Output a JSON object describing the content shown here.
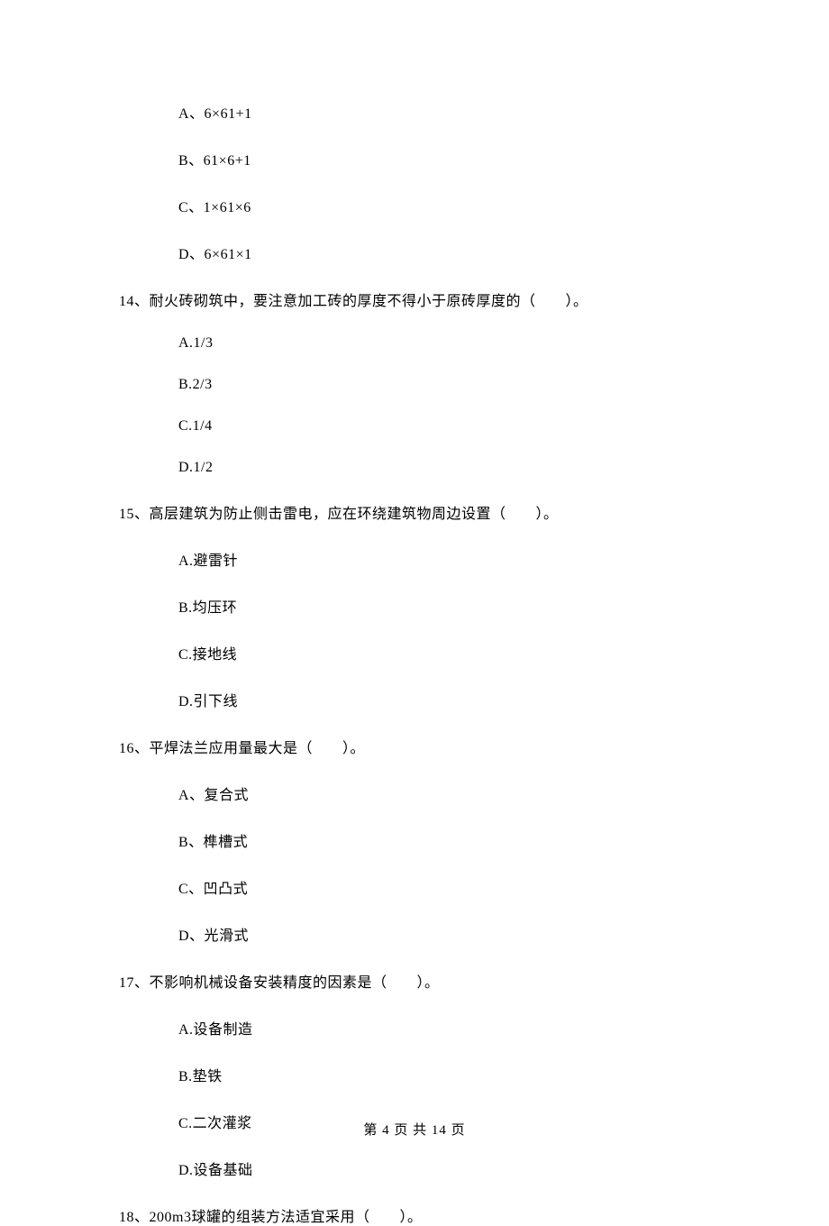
{
  "q13_options": {
    "a": "A、6×61+1",
    "b": "B、61×6+1",
    "c": "C、1×61×6",
    "d": "D、6×61×1"
  },
  "q14": {
    "text": "14、耐火砖砌筑中，要注意加工砖的厚度不得小于原砖厚度的（　　）。",
    "options": {
      "a": "A.1/3",
      "b": "B.2/3",
      "c": "C.1/4",
      "d": "D.1/2"
    }
  },
  "q15": {
    "text": "15、高层建筑为防止侧击雷电，应在环绕建筑物周边设置（　　）。",
    "options": {
      "a": "A.避雷针",
      "b": "B.均压环",
      "c": "C.接地线",
      "d": "D.引下线"
    }
  },
  "q16": {
    "text": "16、平焊法兰应用量最大是（　　）。",
    "options": {
      "a": "A、复合式",
      "b": "B、榫槽式",
      "c": "C、凹凸式",
      "d": "D、光滑式"
    }
  },
  "q17": {
    "text": "17、不影响机械设备安装精度的因素是（　　）。",
    "options": {
      "a": "A.设备制造",
      "b": "B.垫铁",
      "c": "C.二次灌浆",
      "d": "D.设备基础"
    }
  },
  "q18": {
    "text": "18、200m3球罐的组装方法适宜采用（　　）。"
  },
  "footer": "第 4 页 共 14 页"
}
